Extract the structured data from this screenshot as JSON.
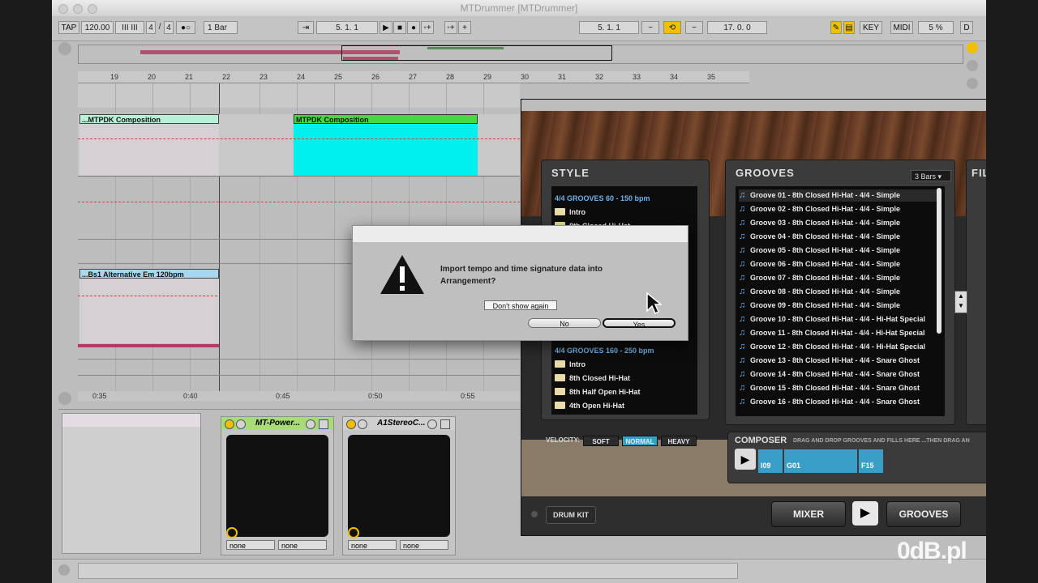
{
  "window": {
    "title": "MTDrummer  [MTDrummer]"
  },
  "control_bar": {
    "tap": "TAP",
    "tempo": "120.00",
    "nudge": "III III",
    "signature_num": "4",
    "signature_sep": "/",
    "signature_den": "4",
    "metronome": "●○",
    "quantize": "1 Bar",
    "follow": "⇥",
    "song_position": "5.  1.  1",
    "play": "▶",
    "stop": "■",
    "record": "●",
    "overdub": "◦+",
    "add": "+",
    "loop_start": "5.  1.  1",
    "loop_length": "17.  0.  0",
    "key": "KEY",
    "midi": "MIDI",
    "cpu": "5 %",
    "d": "D"
  },
  "ruler": {
    "bars": [
      "19",
      "20",
      "21",
      "22",
      "23",
      "24",
      "25",
      "26",
      "27",
      "28",
      "29",
      "30",
      "31",
      "32",
      "33",
      "34",
      "35"
    ]
  },
  "time_ruler": {
    "times": [
      "0:35",
      "0:40",
      "0:45",
      "0:50",
      "0:55"
    ]
  },
  "tracks": {
    "clip1": "...MTPDK Composition",
    "clip2": "MTPDK Composition",
    "clip3": "...Bs1 Alternative Em 120bpm"
  },
  "devices": [
    {
      "name": "MT-Power...",
      "sel1": "none",
      "sel2": "none"
    },
    {
      "name": "A1StereoC...",
      "sel1": "none",
      "sel2": "none"
    }
  ],
  "plugin": {
    "style_title": "STYLE",
    "grooves_title": "GROOVES",
    "fills_title": "FIL",
    "bars_select": "3 Bars",
    "style_categories": [
      {
        "label": "4/4 GROOVES 60 - 150 bpm",
        "items": [
          "Intro",
          "8th Closed Hi-Hat"
        ]
      },
      {
        "label": "4/4 GROOVES 160 - 250 bpm",
        "items": [
          "Intro",
          "8th Closed Hi-Hat",
          "8th Half Open Hi-Hat",
          "4th Open Hi-Hat"
        ]
      }
    ],
    "grooves": [
      "Groove 01 - 8th Closed Hi-Hat - 4/4 - Simple",
      "Groove 02 - 8th Closed Hi-Hat - 4/4 - Simple",
      "Groove 03 - 8th Closed Hi-Hat - 4/4 - Simple",
      "Groove 04 - 8th Closed Hi-Hat - 4/4 - Simple",
      "Groove 05 - 8th Closed Hi-Hat - 4/4 - Simple",
      "Groove 06 - 8th Closed Hi-Hat - 4/4 - Simple",
      "Groove 07 - 8th Closed Hi-Hat - 4/4 - Simple",
      "Groove 08 - 8th Closed Hi-Hat - 4/4 - Simple",
      "Groove 09 - 8th Closed Hi-Hat - 4/4 - Simple",
      "Groove 10 - 8th Closed Hi-Hat - 4/4 - Hi-Hat Special",
      "Groove 11 - 8th Closed Hi-Hat - 4/4 - Hi-Hat Special",
      "Groove 12 - 8th Closed Hi-Hat - 4/4 - Hi-Hat Special",
      "Groove 13 - 8th Closed Hi-Hat - 4/4 - Snare Ghost",
      "Groove 14 - 8th Closed Hi-Hat - 4/4 - Snare Ghost",
      "Groove 15 - 8th Closed Hi-Hat - 4/4 - Snare Ghost",
      "Groove 16 - 8th Closed Hi-Hat - 4/4 - Snare Ghost"
    ],
    "velocity_label": "VELOCITY:",
    "velocity": [
      "SOFT",
      "NORMAL",
      "HEAVY"
    ],
    "composer_title": "COMPOSER",
    "composer_hint": "DRAG AND DROP GROOVES AND FILLS HERE  ...THEN DRAG AN",
    "composer_segments": [
      "I09",
      "G01",
      "F15"
    ],
    "drum_kit": "DRUM KIT",
    "mixer": "MIXER",
    "grooves_btn": "GROOVES"
  },
  "dialog": {
    "message": "Import tempo and time signature data into Arrangement?",
    "dont_show": "Don't show again",
    "no": "No",
    "yes": "Yes"
  },
  "watermark": "0dB.pl"
}
